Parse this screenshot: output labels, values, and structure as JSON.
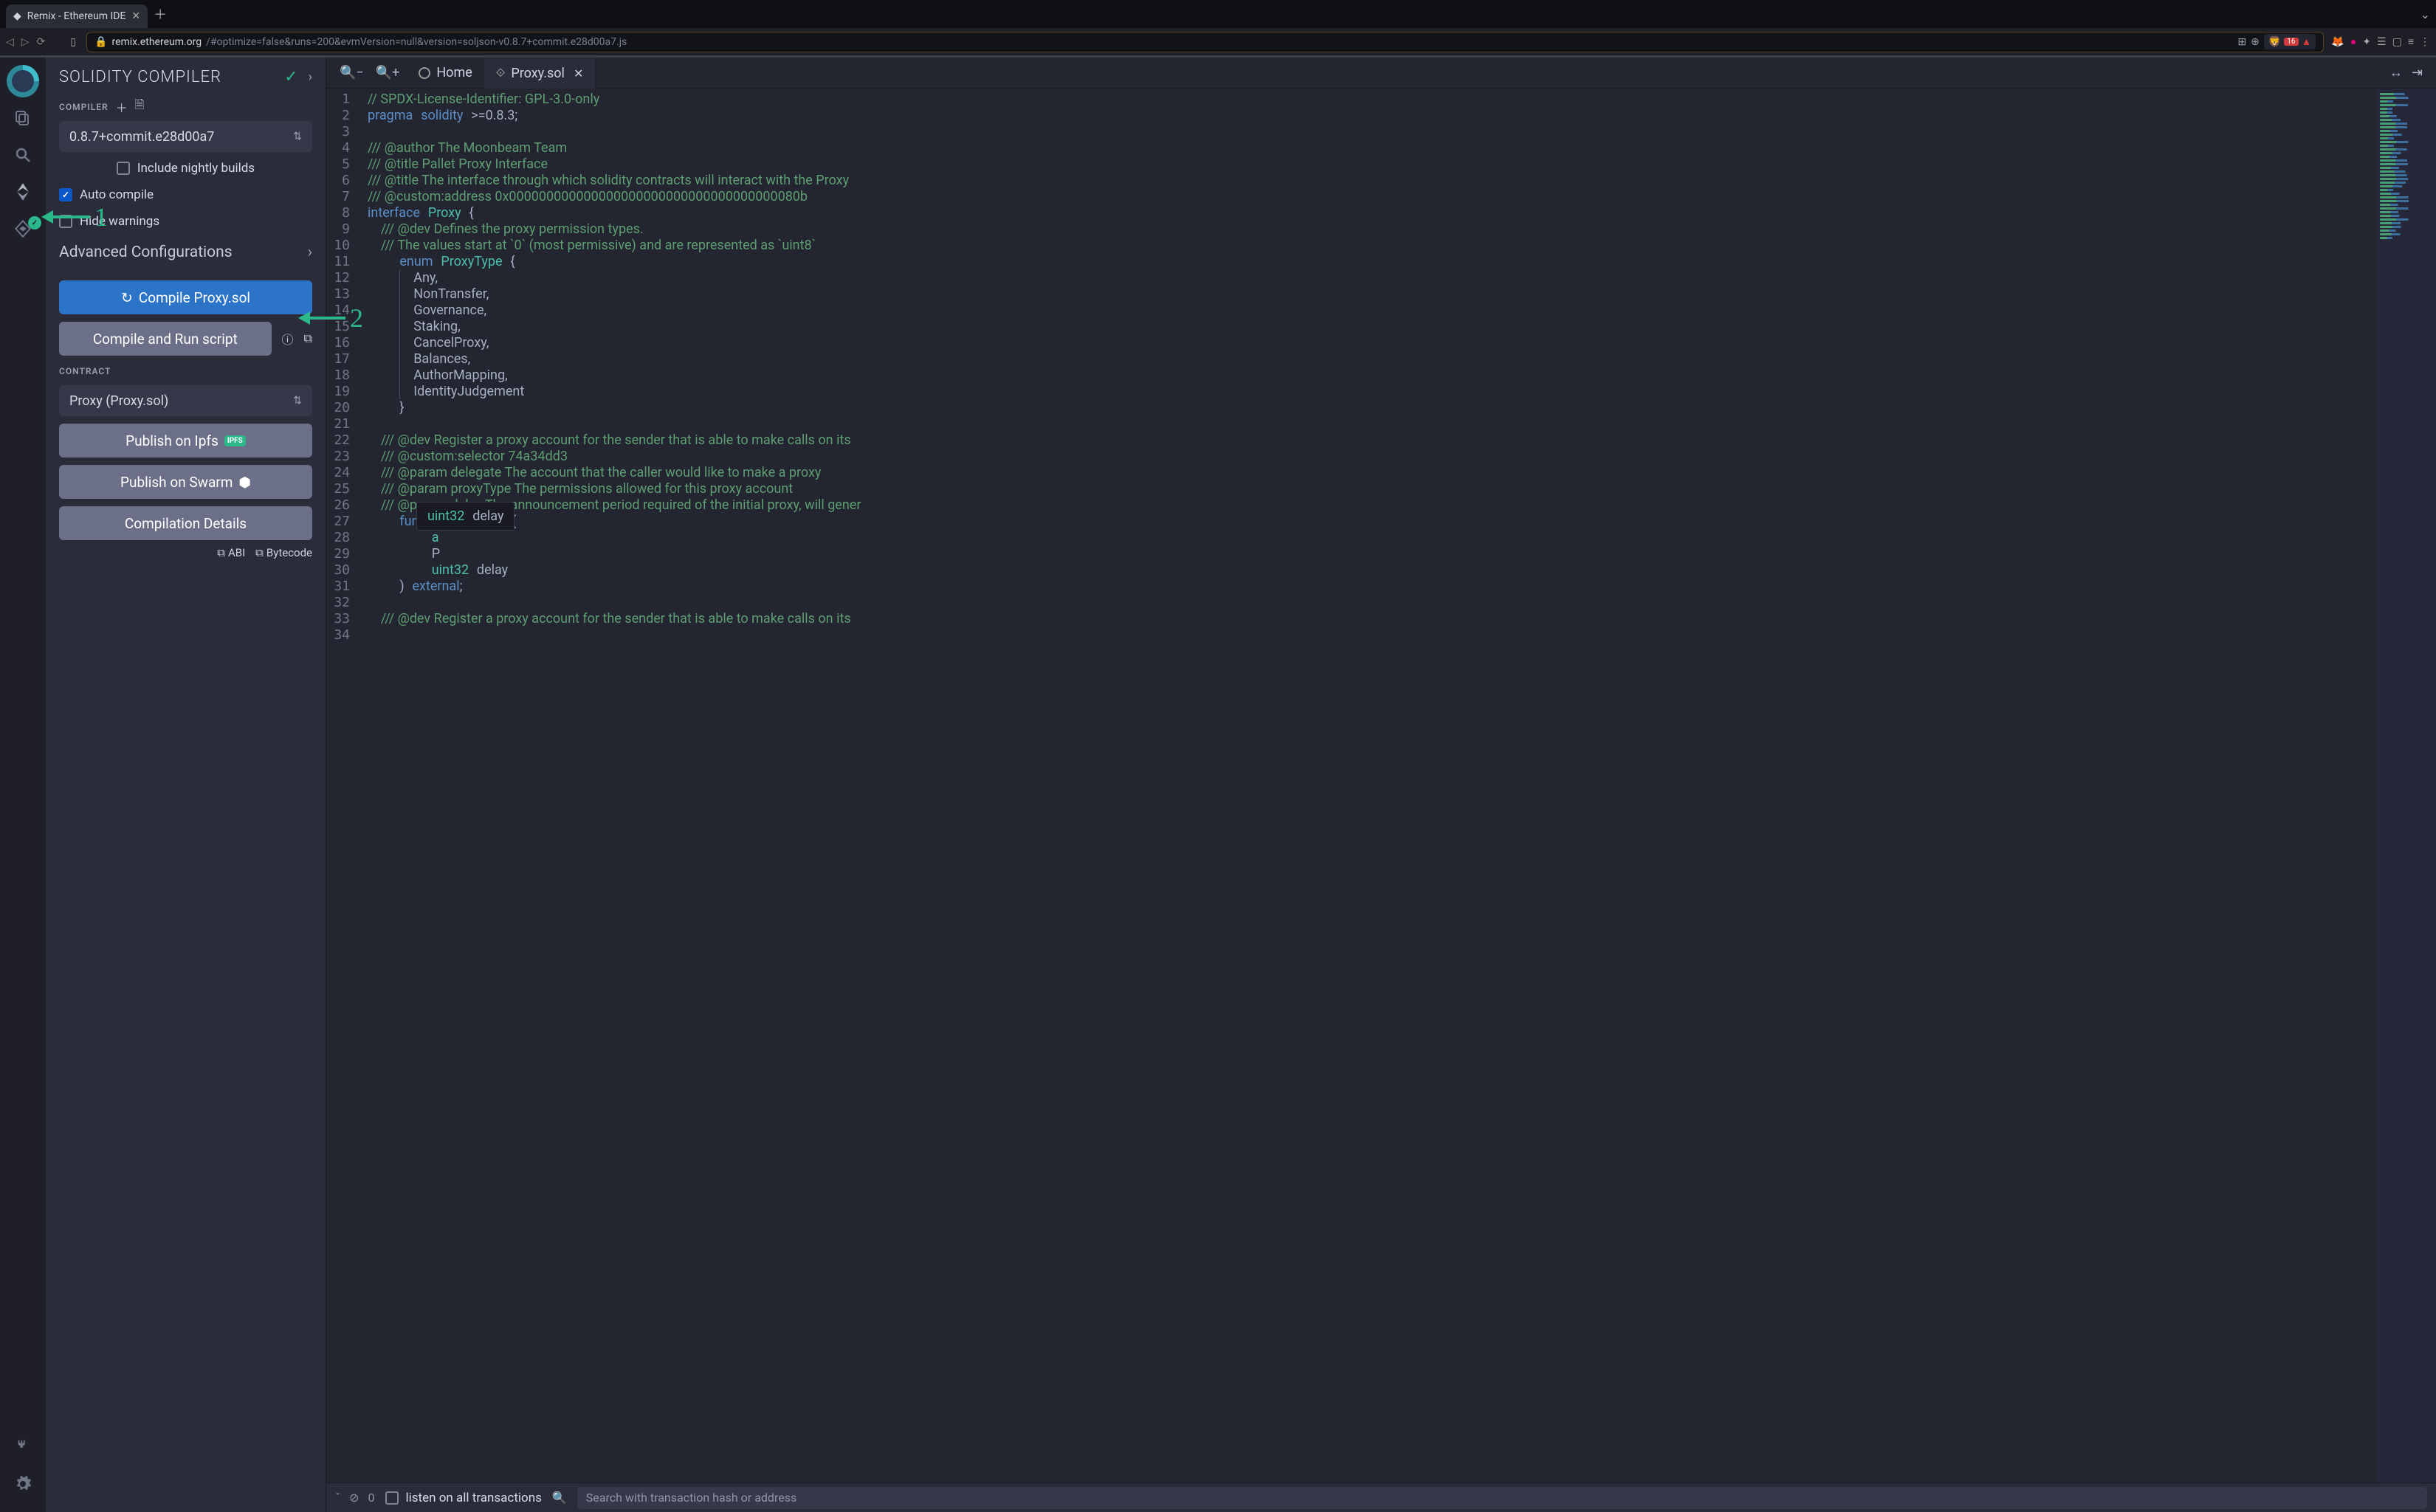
{
  "browser": {
    "tab_title": "Remix - Ethereum IDE",
    "url_host": "remix.ethereum.org",
    "url_path": "/#optimize=false&runs=200&evmVersion=null&version=soljson-v0.8.7+commit.e28d00a7.js",
    "shield_badge": "16"
  },
  "panel": {
    "title": "SOLIDITY COMPILER",
    "compiler_label": "COMPILER",
    "compiler_value": "0.8.7+commit.e28d00a7",
    "nightly_label": "Include nightly builds",
    "auto_compile_label": "Auto compile",
    "hide_warnings_label": "Hide warnings",
    "advanced_label": "Advanced Configurations",
    "compile_btn": "Compile Proxy.sol",
    "run_btn": "Compile and Run script",
    "contract_label": "CONTRACT",
    "contract_value": "Proxy (Proxy.sol)",
    "ipfs_btn": "Publish on Ipfs",
    "swarm_btn": "Publish on Swarm",
    "details_btn": "Compilation Details",
    "abi_link": "ABI",
    "bytecode_link": "Bytecode"
  },
  "tabs": {
    "home": "Home",
    "active": "Proxy.sol"
  },
  "term": {
    "listen": "listen on all transactions",
    "search_ph": "Search with transaction hash or address",
    "count": "0"
  },
  "hint": "uint32 delay",
  "annotations": {
    "one": "1",
    "two": "2"
  },
  "code": {
    "lines": [
      "// SPDX-License-Identifier: GPL-3.0-only",
      "pragma solidity >=0.8.3;",
      "",
      "/// @author The Moonbeam Team",
      "/// @title Pallet Proxy Interface",
      "/// @title The interface through which solidity contracts will interact with the Proxy",
      "/// @custom:address 0x000000000000000000000000000000000000080b",
      "interface Proxy {",
      "    /// @dev Defines the proxy permission types.",
      "    /// The values start at `0` (most permissive) and are represented as `uint8`",
      "    enum ProxyType {",
      "        Any,",
      "        NonTransfer,",
      "        Governance,",
      "        Staking,",
      "        CancelProxy,",
      "        Balances,",
      "        AuthorMapping,",
      "        IdentityJudgement",
      "    }",
      "",
      "    /// @dev Register a proxy account for the sender that is able to make calls on its",
      "    /// @custom:selector 74a34dd3",
      "    /// @param delegate The account that the caller would like to make a proxy",
      "    /// @param proxyType The permissions allowed for this proxy account",
      "    /// @param delay The announcement period required of the initial proxy, will gener",
      "    function addProxy(",
      "        a",
      "        P",
      "        uint32 delay",
      "    ) external;",
      "",
      "    /// @dev Register a proxy account for the sender that is able to make calls on its",
      ""
    ]
  }
}
